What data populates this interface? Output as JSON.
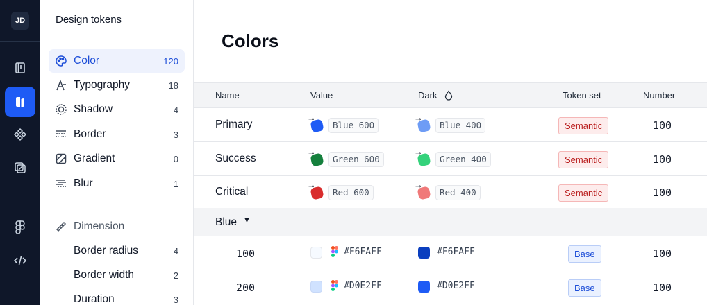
{
  "rail": {
    "avatar": "JD",
    "items": [
      {
        "icon": "book-icon",
        "active": false
      },
      {
        "icon": "tokens-icon",
        "active": true
      },
      {
        "icon": "components-icon",
        "active": false
      },
      {
        "icon": "styles-icon",
        "active": false
      },
      {
        "icon": "figma-icon",
        "active": false
      },
      {
        "icon": "code-icon",
        "active": false
      }
    ]
  },
  "sidebar": {
    "title": "Design tokens",
    "items": [
      {
        "label": "Color",
        "count": "120",
        "icon": "palette-icon",
        "active": true
      },
      {
        "label": "Typography",
        "count": "18",
        "icon": "typography-icon"
      },
      {
        "label": "Shadow",
        "count": "4",
        "icon": "shadow-icon"
      },
      {
        "label": "Border",
        "count": "3",
        "icon": "border-icon"
      },
      {
        "label": "Gradient",
        "count": "0",
        "icon": "gradient-icon"
      },
      {
        "label": "Blur",
        "count": "1",
        "icon": "blur-icon"
      }
    ],
    "dimension": {
      "label": "Dimension",
      "icon": "ruler-icon"
    },
    "dimension_items": [
      {
        "label": "Border radius",
        "count": "4"
      },
      {
        "label": "Border width",
        "count": "2"
      },
      {
        "label": "Duration",
        "count": "3"
      }
    ]
  },
  "main": {
    "title": "Colors",
    "columns": {
      "name": "Name",
      "value": "Value",
      "dark": "Dark",
      "token_set": "Token set",
      "number": "Number"
    },
    "semantic_rows": [
      {
        "name": "Primary",
        "value": "Blue 600",
        "value_color": "#1e5bf5",
        "dark": "Blue 400",
        "dark_color": "#6e9cf5",
        "token_set": "Semantic",
        "number": "100"
      },
      {
        "name": "Success",
        "value": "Green 600",
        "value_color": "#15803d",
        "dark": "Green 400",
        "dark_color": "#34d27b",
        "token_set": "Semantic",
        "number": "100"
      },
      {
        "name": "Critical",
        "value": "Red 600",
        "value_color": "#d92d2d",
        "dark": "Red 400",
        "dark_color": "#f07979",
        "token_set": "Semantic",
        "number": "100"
      }
    ],
    "group": {
      "label": "Blue",
      "caret": "▼"
    },
    "base_rows": [
      {
        "name": "100",
        "value": "#F6FAFF",
        "value_color": "#F6FAFF",
        "dark": "#F6FAFF",
        "dark_color": "#0b3fbf",
        "token_set": "Base",
        "number": "100"
      },
      {
        "name": "200",
        "value": "#D0E2FF",
        "value_color": "#D0E2FF",
        "dark": "#D0E2FF",
        "dark_color": "#1e5bf5",
        "token_set": "Base",
        "number": "100"
      }
    ]
  }
}
